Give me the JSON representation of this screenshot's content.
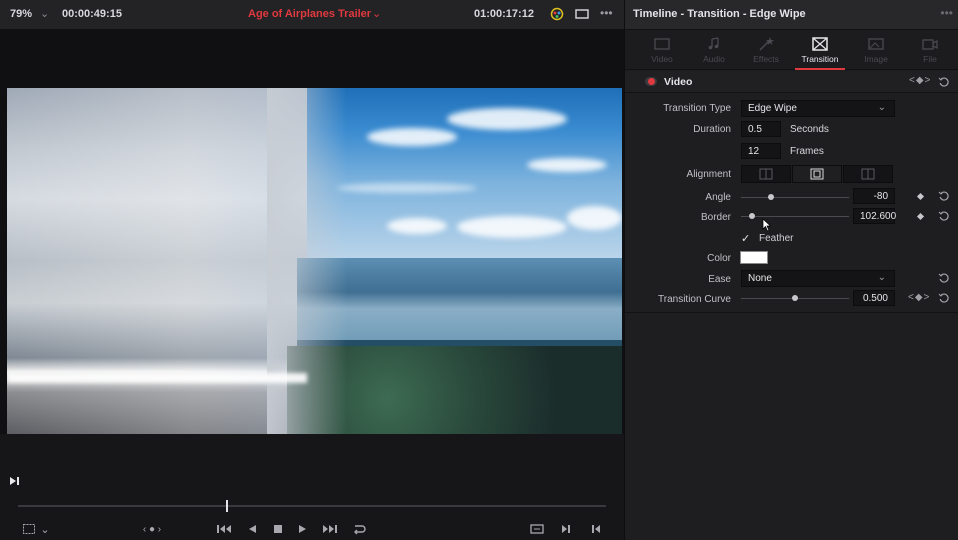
{
  "viewer": {
    "zoom": "79%",
    "source_timecode": "00:00:49:15",
    "clip_title": "Age of Airplanes Trailer",
    "record_timecode": "01:00:17:12"
  },
  "inspector": {
    "title": "Timeline - Transition - Edge Wipe",
    "tabs": [
      {
        "label": "Video"
      },
      {
        "label": "Audio"
      },
      {
        "label": "Effects"
      },
      {
        "label": "Transition"
      },
      {
        "label": "Image"
      },
      {
        "label": "File"
      }
    ],
    "active_tab": "Transition",
    "section": {
      "title": "Video",
      "enabled": true,
      "keyframe_nav": "<◆>"
    },
    "transition_type": {
      "label": "Transition Type",
      "value": "Edge Wipe"
    },
    "duration": {
      "label": "Duration",
      "seconds": "0.5",
      "seconds_unit": "Seconds",
      "frames": "12",
      "frames_unit": "Frames"
    },
    "alignment": {
      "label": "Alignment",
      "selected": "center"
    },
    "angle": {
      "label": "Angle",
      "value": "-80",
      "slider_fraction": 0.28
    },
    "border": {
      "label": "Border",
      "value": "102.600",
      "slider_fraction": 0.1
    },
    "feather": {
      "label": "Feather",
      "checked": true,
      "check_glyph": "✓"
    },
    "color": {
      "label": "Color",
      "value_hex": "#ffffff"
    },
    "ease": {
      "label": "Ease",
      "value": "None"
    },
    "transition_curve": {
      "label": "Transition Curve",
      "value": "0.500",
      "slider_fraction": 0.5,
      "keyframe_nav": "<◆>"
    }
  },
  "colors": {
    "accent_red": "#e0393e",
    "panel_bg": "#1e1e21",
    "field_bg": "#141416"
  }
}
